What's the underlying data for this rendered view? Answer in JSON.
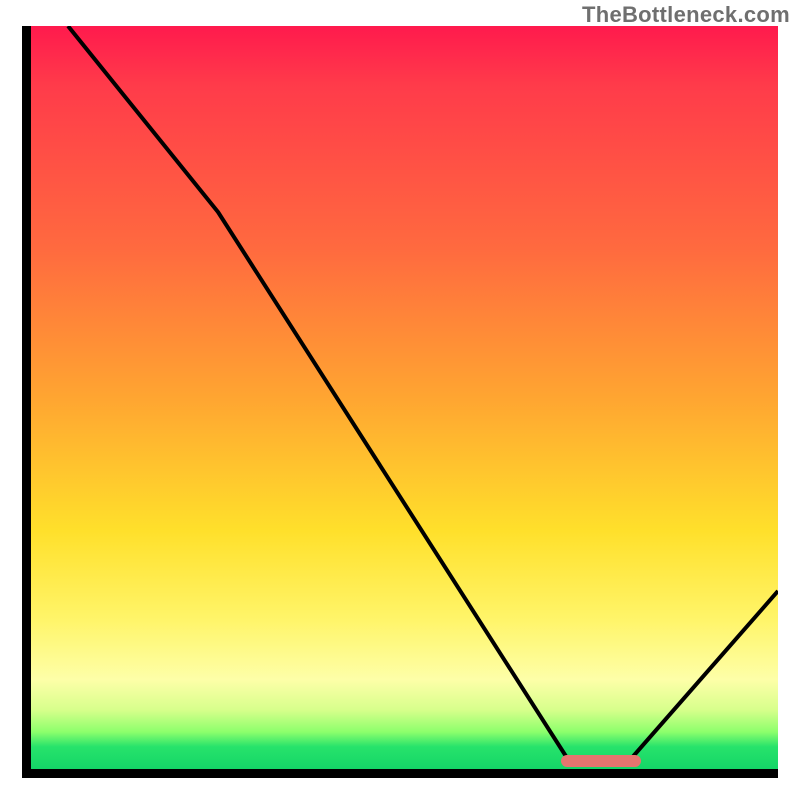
{
  "watermark": "TheBottleneck.com",
  "chart_data": {
    "type": "line",
    "title": "",
    "xlabel": "",
    "ylabel": "",
    "xlim": [
      0,
      100
    ],
    "ylim": [
      0,
      100
    ],
    "grid": false,
    "legend": false,
    "series": [
      {
        "name": "curve",
        "x": [
          5,
          25,
          72,
          80,
          100
        ],
        "y": [
          100,
          75,
          1,
          1,
          24
        ]
      }
    ],
    "marker": {
      "x_start": 72,
      "x_end": 82,
      "y": 1
    },
    "background_gradient": {
      "direction": "vertical",
      "stops": [
        {
          "pct": 0,
          "color": "#ff1a4d"
        },
        {
          "pct": 50,
          "color": "#ffa531"
        },
        {
          "pct": 80,
          "color": "#fff56a"
        },
        {
          "pct": 100,
          "color": "#14d567"
        }
      ]
    }
  },
  "colors": {
    "axis": "#000000",
    "curve": "#000000",
    "marker": "#e7746f",
    "watermark": "#6f6f6f"
  }
}
